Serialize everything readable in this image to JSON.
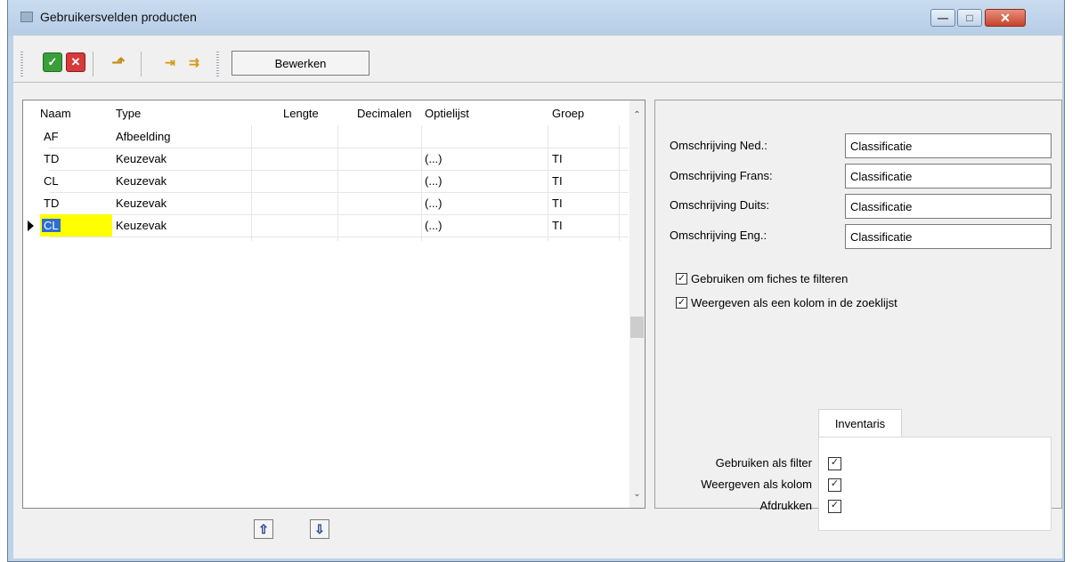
{
  "window": {
    "title": "Gebruikersvelden producten",
    "min_glyph": "—",
    "max_glyph": "□",
    "close_glyph": "✕"
  },
  "toolbar": {
    "ok_glyph": "✓",
    "cancel_glyph": "✕",
    "edit_label": "Bewerken"
  },
  "grid": {
    "columns": [
      "Naam",
      "Type",
      "Lengte",
      "Decimalen",
      "Optielijst",
      "Groep"
    ],
    "rows": [
      {
        "naam": "AF",
        "type": "Afbeelding",
        "lengte": "",
        "decimalen": "",
        "optielijst": "",
        "groep": ""
      },
      {
        "naam": "TD",
        "type": "Keuzevak",
        "lengte": "",
        "decimalen": "",
        "optielijst": "(...)",
        "groep": "TI"
      },
      {
        "naam": "CL",
        "type": "Keuzevak",
        "lengte": "",
        "decimalen": "",
        "optielijst": "(...)",
        "groep": "TI"
      },
      {
        "naam": "TD",
        "type": "Keuzevak",
        "lengte": "",
        "decimalen": "",
        "optielijst": "(...)",
        "groep": "TI"
      },
      {
        "naam": "CL",
        "type": "Keuzevak",
        "lengte": "",
        "decimalen": "",
        "optielijst": "(...)",
        "groep": "TI"
      }
    ],
    "selected_row": 4
  },
  "details": {
    "labels": {
      "ned": "Omschrijving Ned.:",
      "frans": "Omschrijving Frans:",
      "duits": "Omschrijving Duits:",
      "eng": "Omschrijving Eng.:"
    },
    "values": {
      "ned": "Classificatie",
      "frans": "Classificatie",
      "duits": "Classificatie",
      "eng": "Classificatie"
    },
    "filter_checkbox": "Gebruiken om fiches te filteren",
    "column_checkbox": "Weergeven als een kolom in de zoeklijst",
    "tab_label": "Inventaris",
    "inv_filter": "Gebruiken als filter",
    "inv_column": "Weergeven als kolom",
    "inv_print": "Afdrukken",
    "check_glyph": "✓"
  },
  "nav": {
    "up_glyph": "⇧",
    "down_glyph": "⇩"
  }
}
